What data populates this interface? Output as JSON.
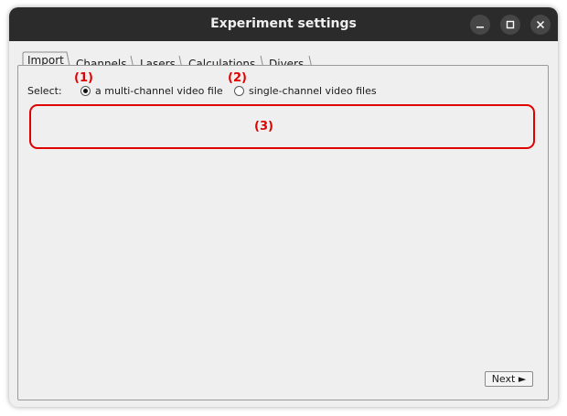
{
  "window": {
    "title": "Experiment settings",
    "controls": [
      "minimize-icon",
      "maximize-icon",
      "close-icon"
    ]
  },
  "tabs": [
    {
      "label": "Import",
      "active": true
    },
    {
      "label": "Channels",
      "active": false
    },
    {
      "label": "Lasers",
      "active": false
    },
    {
      "label": "Calculations",
      "active": false
    },
    {
      "label": "Divers",
      "active": false
    }
  ],
  "import": {
    "select_label": "Select:",
    "options": [
      {
        "label": "a multi-channel video file",
        "selected": true
      },
      {
        "label": "single-channel video files",
        "selected": false
      }
    ]
  },
  "annotations": {
    "one": "(1)",
    "two": "(2)",
    "three": "(3)",
    "color": "#e00000"
  },
  "footer": {
    "next_label": "Next ►"
  },
  "colors": {
    "titlebar": "#2b2b2b",
    "window_bg": "#efefef",
    "annotation": "#e00000"
  }
}
